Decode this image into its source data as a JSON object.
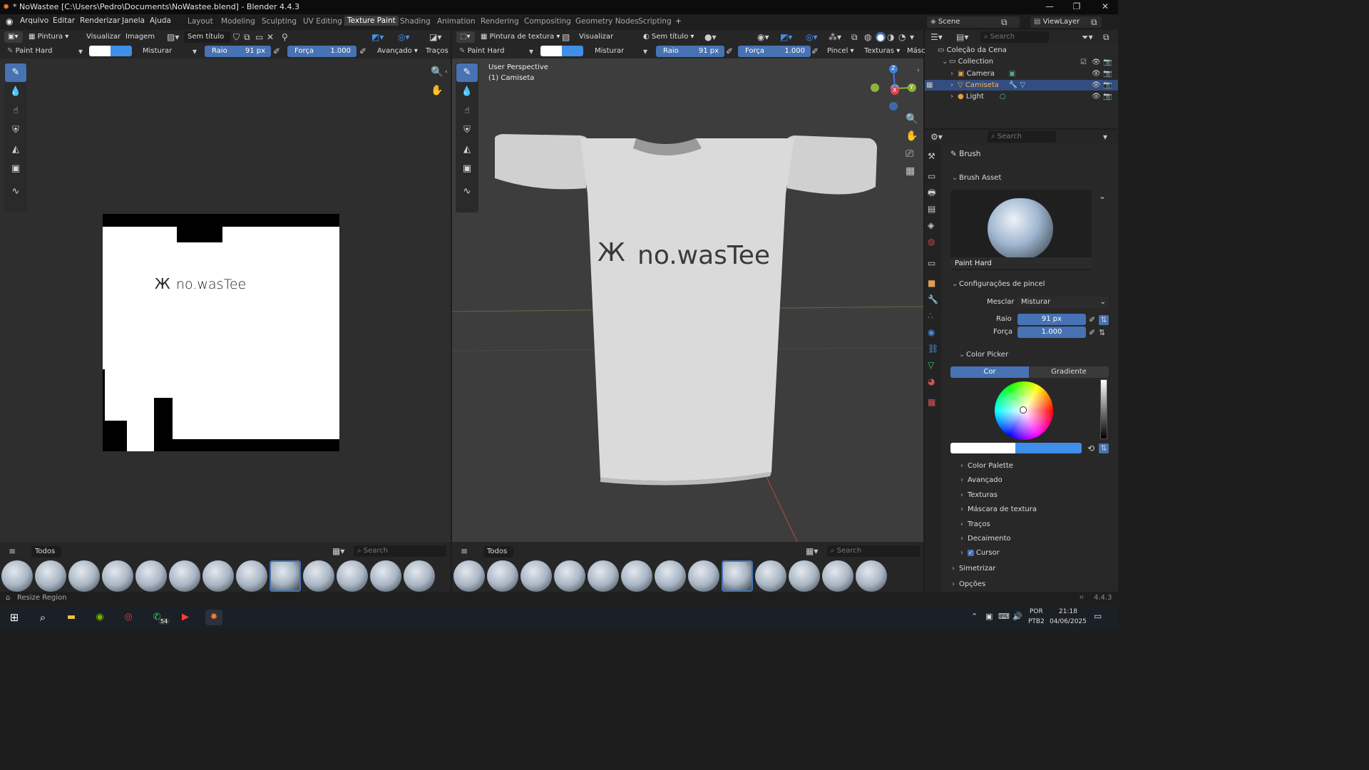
{
  "titlebar": {
    "title": "* NoWastee [C:\\Users\\Pedro\\Documents\\NoWastee.blend] - Blender 4.4.3",
    "icon": "blender-logo-icon"
  },
  "menu": {
    "items": [
      "Arquivo",
      "Editar",
      "Renderizar",
      "Janela",
      "Ajuda"
    ]
  },
  "workspaces": {
    "tabs": [
      "Layout",
      "Modeling",
      "Sculpting",
      "UV Editing",
      "Texture Paint",
      "Shading",
      "Animation",
      "Rendering",
      "Compositing",
      "Geometry Nodes",
      "Scripting"
    ],
    "active": "Texture Paint",
    "add": "+"
  },
  "top_right": {
    "scene": "Scene",
    "view_layer": "ViewLayer"
  },
  "image_editor": {
    "mode": "Pintura",
    "view": "Visualizar",
    "image": "Imagem",
    "image_name": "Sem título",
    "brush": "Paint Hard",
    "blend": "Misturar",
    "radius_label": "Raio",
    "radius": "91 px",
    "strength_label": "Força",
    "strength": "1.000",
    "advanced": "Avançado",
    "strokes": "Traços",
    "logo_text": "no.wasTee"
  },
  "viewport": {
    "mode": "Pintura de textura",
    "view": "Visualizar",
    "image_name": "Sem título",
    "brush": "Paint Hard",
    "blend": "Misturar",
    "radius_label": "Raio",
    "radius": "91 px",
    "strength_label": "Força",
    "strength": "1.000",
    "brush_menu": "Pincel",
    "textures": "Texturas",
    "mask": "Másc",
    "overlay_line1": "User Perspective",
    "overlay_line2": "(1) Camiseta",
    "logo_text": "no.wasTee",
    "gizmo": {
      "x": "X",
      "y": "Y",
      "z": "Z"
    }
  },
  "asset_shelf_left": {
    "tab": "Todos",
    "search": "Search"
  },
  "asset_shelf_right": {
    "tab": "Todos",
    "search": "Search"
  },
  "outliner": {
    "search": "Search",
    "root": "Coleção da Cena",
    "collection": "Collection",
    "items": [
      {
        "name": "Camera",
        "selected": false
      },
      {
        "name": "Camiseta",
        "selected": true
      },
      {
        "name": "Light",
        "selected": false
      }
    ]
  },
  "properties": {
    "search": "Search",
    "title": "Brush",
    "brush_asset_panel": "Brush Asset",
    "brush_name": "Paint Hard",
    "settings_panel": "Configurações de pincel",
    "blend_label": "Mesclar",
    "blend": "Misturar",
    "radius_label": "Raio",
    "radius": "91 px",
    "strength_label": "Força",
    "strength": "1.000",
    "color_picker_panel": "Color Picker",
    "color_tab": "Cor",
    "gradient_tab": "Gradiente",
    "collapsed": [
      "Color Palette",
      "Avançado",
      "Texturas",
      "Máscara de textura",
      "Traços",
      "Decaimento",
      "Cursor"
    ],
    "cursor_checked": true,
    "bottom": [
      "Simetrizar",
      "Opções"
    ],
    "primary_color": "#ffffff",
    "secondary_color": "#3f8ee8"
  },
  "statusbar": {
    "left": "Resize Region",
    "version": "4.4.3"
  },
  "taskbar": {
    "whatsapp_badge": "54",
    "lang1": "POR",
    "lang2": "PTB2",
    "time": "21:18",
    "date": "04/06/2025"
  }
}
